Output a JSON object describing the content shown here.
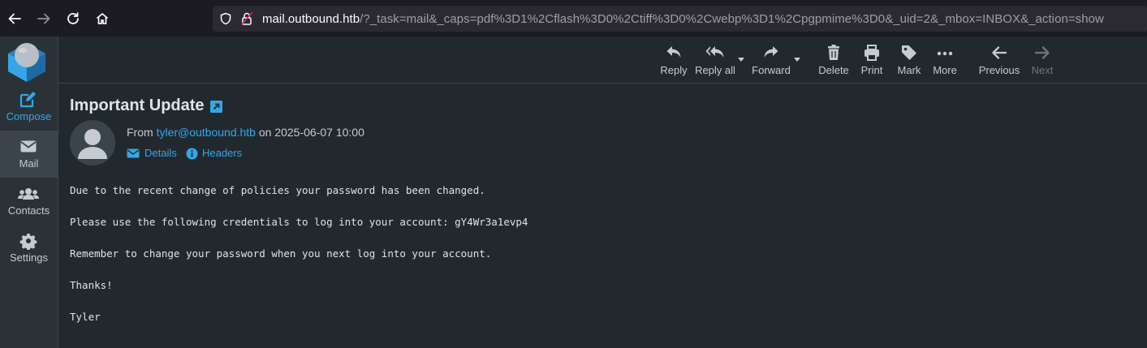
{
  "browser": {
    "url_host": "mail.outbound.htb",
    "url_path": "/?_task=mail&_caps=pdf%3D1%2Cflash%3D0%2Ctiff%3D0%2Cwebp%3D1%2Cpgpmime%3D0&_uid=2&_mbox=INBOX&_action=show",
    "icons": [
      "back-icon",
      "forward-icon",
      "reload-icon",
      "home-icon",
      "shield-icon",
      "insecure-lock-icon"
    ]
  },
  "sidebar": {
    "items": [
      {
        "label": "Compose",
        "icon": "compose-icon"
      },
      {
        "label": "Mail",
        "icon": "envelope-icon"
      },
      {
        "label": "Contacts",
        "icon": "contacts-icon"
      },
      {
        "label": "Settings",
        "icon": "gear-icon"
      }
    ]
  },
  "toolbar": {
    "reply": "Reply",
    "reply_all": "Reply all",
    "forward": "Forward",
    "delete": "Delete",
    "print": "Print",
    "mark": "Mark",
    "more": "More",
    "previous": "Previous",
    "next": "Next"
  },
  "message": {
    "subject": "Important Update",
    "from_prefix": "From",
    "from_address": "tyler@outbound.htb",
    "date_text": "on 2025-06-07 10:00",
    "details_link": "Details",
    "headers_link": "Headers",
    "body_lines": [
      "Due to the recent change of policies your password has been changed.",
      "Please use the following credentials to log into your account: gY4Wr3a1evp4",
      "Remember to change your password when you next log into your account.",
      "Thanks!",
      "Tyler"
    ]
  },
  "colors": {
    "accent": "#33a8e8",
    "background": "#22292e",
    "sidebar": "#2a3238"
  }
}
